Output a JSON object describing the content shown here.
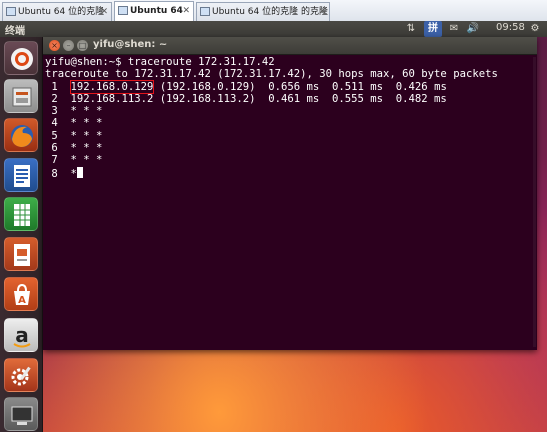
{
  "tabs": [
    {
      "label": "Ubuntu 64 位的克隆",
      "active": false
    },
    {
      "label": "Ubuntu 64",
      "active": true
    },
    {
      "label": "Ubuntu 64 位的克隆 的克隆",
      "active": false
    }
  ],
  "panel": {
    "app_title": "终端",
    "input_method_label": "拼",
    "clock": "09:58"
  },
  "launcher": {
    "items": [
      "dash-home",
      "files",
      "firefox",
      "libreoffice-writer",
      "libreoffice-calc",
      "libreoffice-impress",
      "ubuntu-software-center",
      "amazon",
      "system-settings",
      "workspace-switcher"
    ]
  },
  "terminal": {
    "title": "yifu@shen: ~",
    "prompt": "yifu@shen:~$ traceroute 172.31.17.42",
    "header": "traceroute to 172.31.17.42 (172.31.17.42), 30 hops max, 60 byte packets",
    "hop1_num": " 1  ",
    "hop1_host": "192.168.0.129",
    "hop1_rest": " (192.168.0.129)  0.656 ms  0.511 ms  0.426 ms",
    "hop2": " 2  192.168.113.2 (192.168.113.2)  0.461 ms  0.555 ms  0.482 ms",
    "hop3": " 3  * * *",
    "hop4": " 4  * * *",
    "hop5": " 5  * * *",
    "hop6": " 6  * * *",
    "hop7": " 7  * * *",
    "hop8": " 8  *"
  },
  "colors": {
    "terminal_bg": "#2c001e",
    "highlight_box": "#e0141b",
    "panel_bg": "#3b3a36"
  }
}
